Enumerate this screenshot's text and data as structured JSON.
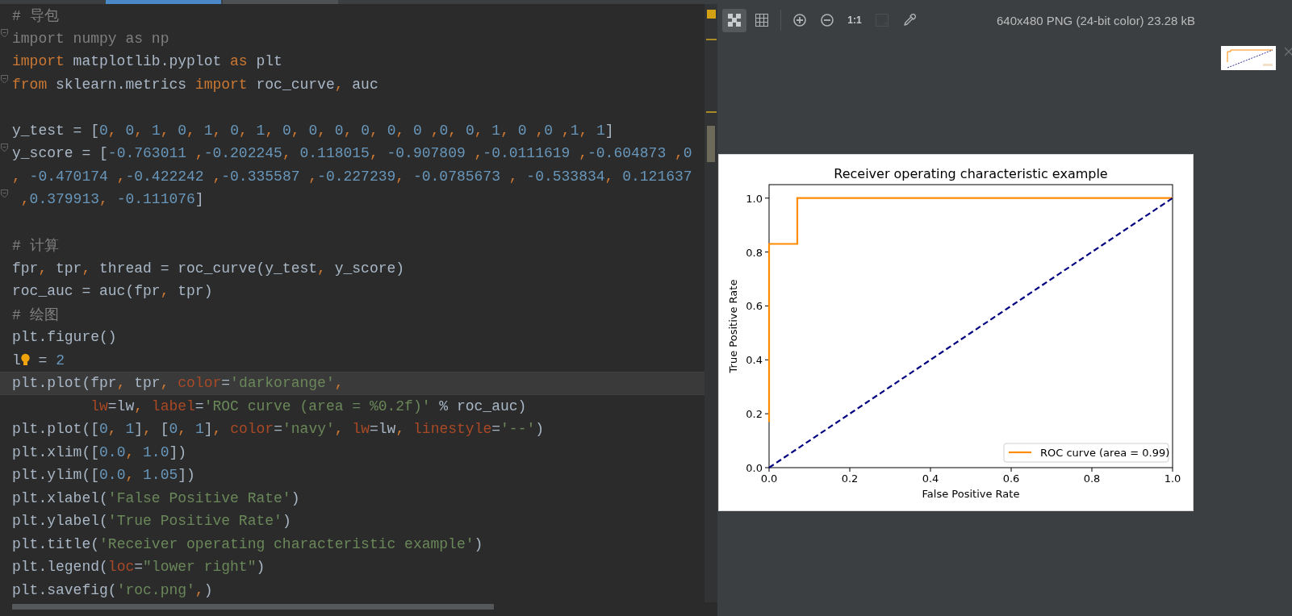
{
  "editor_tabs": [
    {
      "selected": true
    },
    {
      "selected": false
    }
  ],
  "code_lines": [
    {
      "fold": false,
      "current": false,
      "tokens": [
        {
          "text": "# 导包",
          "kind": "cmt"
        }
      ]
    },
    {
      "fold": true,
      "current": false,
      "tokens": [
        {
          "text": "import numpy as np",
          "kind": "dim"
        }
      ]
    },
    {
      "fold": false,
      "current": false,
      "tokens": [
        {
          "text": "import",
          "kind": "kw"
        },
        {
          "text": " matplotlib.pyplot ",
          "kind": "txt"
        },
        {
          "text": "as",
          "kind": "kw"
        },
        {
          "text": " plt",
          "kind": "txt"
        }
      ]
    },
    {
      "fold": true,
      "current": false,
      "tokens": [
        {
          "text": "from",
          "kind": "kw"
        },
        {
          "text": " sklearn.metrics ",
          "kind": "txt"
        },
        {
          "text": "import",
          "kind": "kw"
        },
        {
          "text": " roc_curve",
          "kind": "txt"
        },
        {
          "text": ",",
          "kind": "kw"
        },
        {
          "text": " auc",
          "kind": "txt"
        }
      ]
    },
    {
      "fold": false,
      "current": false
    },
    {
      "fold": false,
      "current": false,
      "tokens": [
        {
          "text": "y_test = [",
          "kind": "txt"
        },
        {
          "text": "0",
          "kind": "num"
        },
        {
          "text": ", ",
          "kind": "kw"
        },
        {
          "text": "0",
          "kind": "num"
        },
        {
          "text": ", ",
          "kind": "kw"
        },
        {
          "text": "1",
          "kind": "num"
        },
        {
          "text": ", ",
          "kind": "kw"
        },
        {
          "text": "0",
          "kind": "num"
        },
        {
          "text": ", ",
          "kind": "kw"
        },
        {
          "text": "1",
          "kind": "num"
        },
        {
          "text": ", ",
          "kind": "kw"
        },
        {
          "text": "0",
          "kind": "num"
        },
        {
          "text": ", ",
          "kind": "kw"
        },
        {
          "text": "1",
          "kind": "num"
        },
        {
          "text": ", ",
          "kind": "kw"
        },
        {
          "text": "0",
          "kind": "num"
        },
        {
          "text": ", ",
          "kind": "kw"
        },
        {
          "text": "0",
          "kind": "num"
        },
        {
          "text": ", ",
          "kind": "kw"
        },
        {
          "text": "0",
          "kind": "num"
        },
        {
          "text": ", ",
          "kind": "kw"
        },
        {
          "text": "0",
          "kind": "num"
        },
        {
          "text": ", ",
          "kind": "kw"
        },
        {
          "text": "0",
          "kind": "num"
        },
        {
          "text": ", ",
          "kind": "kw"
        },
        {
          "text": "0",
          "kind": "num"
        },
        {
          "text": " ,",
          "kind": "kw"
        },
        {
          "text": "0",
          "kind": "num"
        },
        {
          "text": ", ",
          "kind": "kw"
        },
        {
          "text": "0",
          "kind": "num"
        },
        {
          "text": ", ",
          "kind": "kw"
        },
        {
          "text": "1",
          "kind": "num"
        },
        {
          "text": ", ",
          "kind": "kw"
        },
        {
          "text": "0",
          "kind": "num"
        },
        {
          "text": " ,",
          "kind": "kw"
        },
        {
          "text": "0",
          "kind": "num"
        },
        {
          "text": " ,",
          "kind": "kw"
        },
        {
          "text": "1",
          "kind": "num"
        },
        {
          "text": ", ",
          "kind": "kw"
        },
        {
          "text": "1",
          "kind": "num"
        },
        {
          "text": "]",
          "kind": "txt"
        }
      ]
    },
    {
      "fold": true,
      "current": false,
      "tokens": [
        {
          "text": "y_score = [",
          "kind": "txt"
        },
        {
          "text": "-0.763011",
          "kind": "num"
        },
        {
          "text": " ,",
          "kind": "kw"
        },
        {
          "text": "-0.202245",
          "kind": "num"
        },
        {
          "text": ", ",
          "kind": "kw"
        },
        {
          "text": "0.118015",
          "kind": "num"
        },
        {
          "text": ", ",
          "kind": "kw"
        },
        {
          "text": "-0.907809",
          "kind": "num"
        },
        {
          "text": " ,",
          "kind": "kw"
        },
        {
          "text": "-0.0111619",
          "kind": "num"
        },
        {
          "text": " ,",
          "kind": "kw"
        },
        {
          "text": "-0.604873",
          "kind": "num"
        },
        {
          "text": " ,",
          "kind": "kw"
        },
        {
          "text": "0",
          "kind": "num"
        }
      ]
    },
    {
      "fold": false,
      "current": false,
      "tokens": [
        {
          "text": ", ",
          "kind": "kw"
        },
        {
          "text": "-0.470174",
          "kind": "num"
        },
        {
          "text": " ,",
          "kind": "kw"
        },
        {
          "text": "-0.422242",
          "kind": "num"
        },
        {
          "text": " ,",
          "kind": "kw"
        },
        {
          "text": "-0.335587",
          "kind": "num"
        },
        {
          "text": " ,",
          "kind": "kw"
        },
        {
          "text": "-0.227239",
          "kind": "num"
        },
        {
          "text": ", ",
          "kind": "kw"
        },
        {
          "text": "-0.0785673",
          "kind": "num"
        },
        {
          "text": " , ",
          "kind": "kw"
        },
        {
          "text": "-0.533834",
          "kind": "num"
        },
        {
          "text": ", ",
          "kind": "kw"
        },
        {
          "text": "0.121637",
          "kind": "num"
        }
      ]
    },
    {
      "fold": true,
      "current": false,
      "tokens": [
        {
          "text": " ,",
          "kind": "kw"
        },
        {
          "text": "0.379913",
          "kind": "num"
        },
        {
          "text": ", ",
          "kind": "kw"
        },
        {
          "text": "-0.111076",
          "kind": "num"
        },
        {
          "text": "]",
          "kind": "txt"
        }
      ]
    },
    {
      "fold": false,
      "current": false
    },
    {
      "fold": false,
      "current": false,
      "tokens": [
        {
          "text": "# 计算",
          "kind": "cmt"
        }
      ]
    },
    {
      "fold": false,
      "current": false,
      "tokens": [
        {
          "text": "fpr",
          "kind": "txt"
        },
        {
          "text": ", ",
          "kind": "kw"
        },
        {
          "text": "tpr",
          "kind": "txt"
        },
        {
          "text": ", ",
          "kind": "kw"
        },
        {
          "text": "thread = roc_curve(y_test",
          "kind": "txt"
        },
        {
          "text": ", ",
          "kind": "kw"
        },
        {
          "text": "y_score)",
          "kind": "txt"
        }
      ]
    },
    {
      "fold": false,
      "current": false,
      "tokens": [
        {
          "text": "roc_auc = auc(fpr",
          "kind": "txt"
        },
        {
          "text": ", ",
          "kind": "kw"
        },
        {
          "text": "tpr)",
          "kind": "txt"
        }
      ]
    },
    {
      "fold": false,
      "current": false,
      "tokens": [
        {
          "text": "# 绘图",
          "kind": "cmt"
        }
      ]
    },
    {
      "fold": false,
      "current": false,
      "tokens": [
        {
          "text": "plt.figure()",
          "kind": "txt"
        }
      ]
    },
    {
      "fold": false,
      "current": false,
      "tokens": [
        {
          "text": "l",
          "kind": "txt"
        },
        {
          "kind": "bulb"
        },
        {
          "text": " = ",
          "kind": "txt"
        },
        {
          "text": "2",
          "kind": "num"
        }
      ]
    },
    {
      "fold": false,
      "current": true,
      "tokens": [
        {
          "text": "plt.plot(fpr",
          "kind": "txt"
        },
        {
          "text": ", ",
          "kind": "kw"
        },
        {
          "text": "tpr",
          "kind": "txt"
        },
        {
          "text": ", ",
          "kind": "kw"
        },
        {
          "text": "color",
          "kind": "param"
        },
        {
          "text": "=",
          "kind": "txt"
        },
        {
          "text": "'darkorange'",
          "kind": "str"
        },
        {
          "text": ",",
          "kind": "kw"
        }
      ]
    },
    {
      "fold": false,
      "current": false,
      "continuation": true,
      "tokens": [
        {
          "text": "lw",
          "kind": "param"
        },
        {
          "text": "=lw",
          "kind": "txt"
        },
        {
          "text": ", ",
          "kind": "kw"
        },
        {
          "text": "label",
          "kind": "param"
        },
        {
          "text": "=",
          "kind": "txt"
        },
        {
          "text": "'ROC curve (area = %0.2f)'",
          "kind": "str"
        },
        {
          "text": " % roc_auc)",
          "kind": "txt"
        }
      ]
    },
    {
      "fold": false,
      "current": false,
      "tokens": [
        {
          "text": "plt.plot([",
          "kind": "txt"
        },
        {
          "text": "0",
          "kind": "num"
        },
        {
          "text": ", ",
          "kind": "kw"
        },
        {
          "text": "1",
          "kind": "num"
        },
        {
          "text": "]",
          "kind": "txt"
        },
        {
          "text": ", ",
          "kind": "kw"
        },
        {
          "text": "[",
          "kind": "txt"
        },
        {
          "text": "0",
          "kind": "num"
        },
        {
          "text": ", ",
          "kind": "kw"
        },
        {
          "text": "1",
          "kind": "num"
        },
        {
          "text": "]",
          "kind": "txt"
        },
        {
          "text": ", ",
          "kind": "kw"
        },
        {
          "text": "color",
          "kind": "param"
        },
        {
          "text": "=",
          "kind": "txt"
        },
        {
          "text": "'navy'",
          "kind": "str"
        },
        {
          "text": ", ",
          "kind": "kw"
        },
        {
          "text": "lw",
          "kind": "param"
        },
        {
          "text": "=lw",
          "kind": "txt"
        },
        {
          "text": ", ",
          "kind": "kw"
        },
        {
          "text": "linestyle",
          "kind": "param"
        },
        {
          "text": "=",
          "kind": "txt"
        },
        {
          "text": "'--'",
          "kind": "str"
        },
        {
          "text": ")",
          "kind": "txt"
        }
      ]
    },
    {
      "fold": false,
      "current": false,
      "tokens": [
        {
          "text": "plt.xlim([",
          "kind": "txt"
        },
        {
          "text": "0.0",
          "kind": "num"
        },
        {
          "text": ", ",
          "kind": "kw"
        },
        {
          "text": "1.0",
          "kind": "num"
        },
        {
          "text": "])",
          "kind": "txt"
        }
      ]
    },
    {
      "fold": false,
      "current": false,
      "tokens": [
        {
          "text": "plt.ylim([",
          "kind": "txt"
        },
        {
          "text": "0.0",
          "kind": "num"
        },
        {
          "text": ", ",
          "kind": "kw"
        },
        {
          "text": "1.05",
          "kind": "num"
        },
        {
          "text": "])",
          "kind": "txt"
        }
      ]
    },
    {
      "fold": false,
      "current": false,
      "tokens": [
        {
          "text": "plt.xlabel(",
          "kind": "txt"
        },
        {
          "text": "'False Positive Rate'",
          "kind": "str"
        },
        {
          "text": ")",
          "kind": "txt"
        }
      ]
    },
    {
      "fold": false,
      "current": false,
      "tokens": [
        {
          "text": "plt.ylabel(",
          "kind": "txt"
        },
        {
          "text": "'True Positive Rate'",
          "kind": "str"
        },
        {
          "text": ")",
          "kind": "txt"
        }
      ]
    },
    {
      "fold": false,
      "current": false,
      "tokens": [
        {
          "text": "plt.title(",
          "kind": "txt"
        },
        {
          "text": "'Receiver operating characteristic example'",
          "kind": "str"
        },
        {
          "text": ")",
          "kind": "txt"
        }
      ]
    },
    {
      "fold": false,
      "current": false,
      "tokens": [
        {
          "text": "plt.legend(",
          "kind": "txt"
        },
        {
          "text": "loc",
          "kind": "param"
        },
        {
          "text": "=",
          "kind": "txt"
        },
        {
          "text": "\"lower right\"",
          "kind": "str"
        },
        {
          "text": ")",
          "kind": "txt"
        }
      ]
    },
    {
      "fold": false,
      "current": false,
      "tokens": [
        {
          "text": "plt.savefig(",
          "kind": "txt"
        },
        {
          "text": "'roc.png'",
          "kind": "str"
        },
        {
          "text": ",",
          "kind": "kw"
        },
        {
          "text": ")",
          "kind": "txt"
        }
      ]
    }
  ],
  "viewer": {
    "tools": [
      {
        "kind": "transparency",
        "on": true,
        "disabled": false
      },
      {
        "kind": "grid",
        "on": false,
        "disabled": false
      },
      {
        "kind": "zoom-in",
        "on": false,
        "disabled": false
      },
      {
        "kind": "zoom-out",
        "on": false,
        "disabled": false
      },
      {
        "kind": "actual-size",
        "label": "1:1",
        "on": false,
        "disabled": false
      },
      {
        "kind": "fit",
        "on": false,
        "disabled": true
      },
      {
        "kind": "color-picker",
        "on": false,
        "disabled": false
      }
    ],
    "image_info": "640x480 PNG (24-bit color) 23.28 kB",
    "image": {
      "chart_data": {
        "type": "line",
        "title": "Receiver operating characteristic example",
        "xlabel": "False Positive Rate",
        "ylabel": "True Positive Rate",
        "x": [
          0,
          0,
          0.07,
          0.07,
          1
        ],
        "series": [
          {
            "name": "ROC curve (area = 0.99)",
            "color": "#ff8c00",
            "line_style": "solid",
            "values": [
              0.17,
              0.83,
              0.83,
              1,
              1
            ]
          },
          {
            "color": "#000080",
            "line_style": "dashed",
            "values": [
              0,
              0,
              0.07,
              0.07,
              1
            ]
          }
        ],
        "xlim": [
          0,
          1
        ],
        "ylim": [
          0,
          1.05
        ],
        "xticks": [
          {
            "value": 0,
            "label": "0.0"
          },
          {
            "value": 0.2,
            "label": "0.2"
          },
          {
            "value": 0.4,
            "label": "0.4"
          },
          {
            "value": 0.6,
            "label": "0.6"
          },
          {
            "value": 0.8,
            "label": "0.8"
          },
          {
            "value": 1,
            "label": "1.0"
          }
        ],
        "yticks": [
          {
            "value": 0,
            "label": "0.0"
          },
          {
            "value": 0.2,
            "label": "0.2"
          },
          {
            "value": 0.4,
            "label": "0.4"
          },
          {
            "value": 0.6,
            "label": "0.6"
          },
          {
            "value": 0.8,
            "label": "0.8"
          },
          {
            "value": 1,
            "label": "1.0"
          }
        ]
      }
    }
  }
}
